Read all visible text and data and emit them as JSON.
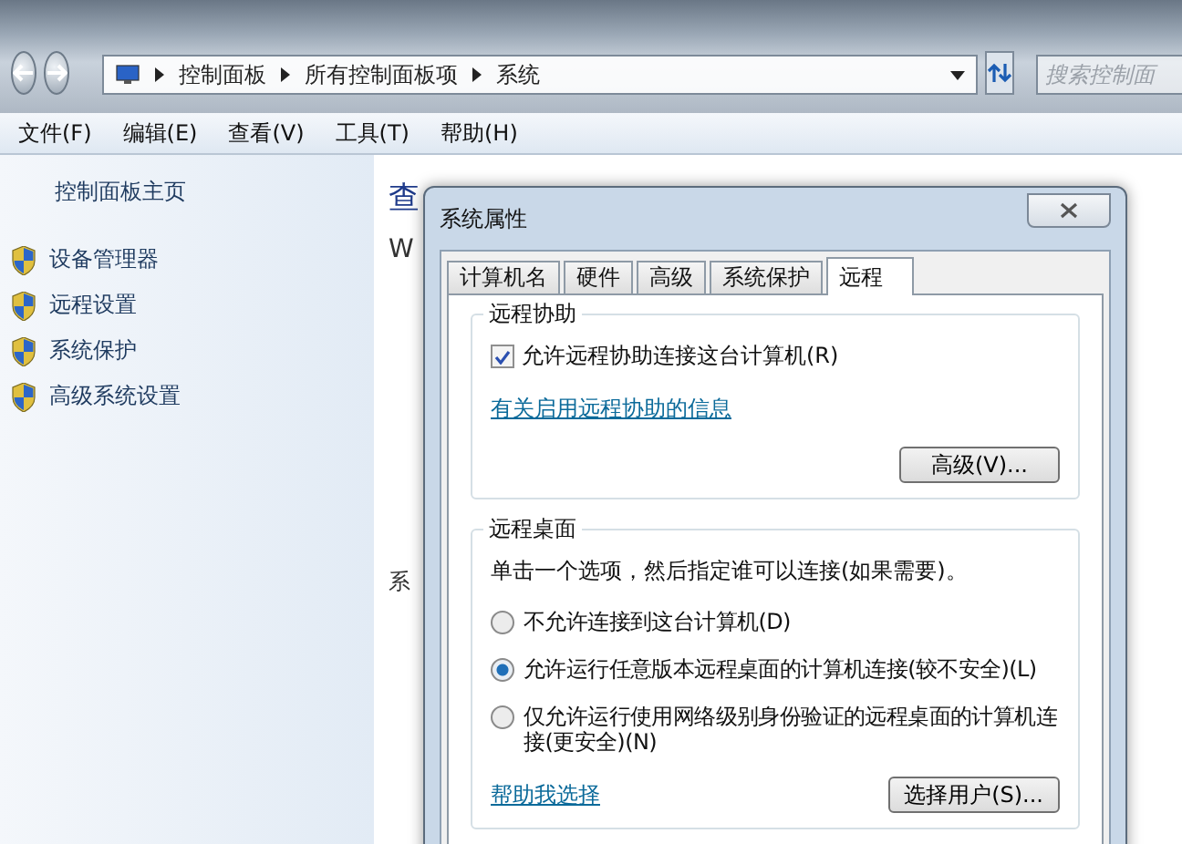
{
  "address_bar": {
    "crumbs": [
      "控制面板",
      "所有控制面板项",
      "系统"
    ]
  },
  "search": {
    "placeholder": "搜索控制面"
  },
  "menu": [
    "文件(F)",
    "编辑(E)",
    "查看(V)",
    "工具(T)",
    "帮助(H)"
  ],
  "sidebar": {
    "home": "控制面板主页",
    "items": [
      "设备管理器",
      "远程设置",
      "系统保护",
      "高级系统设置"
    ]
  },
  "main_fragments": [
    "查",
    "W",
    "系"
  ],
  "dialog": {
    "title": "系统属性",
    "tabs": [
      {
        "label": "计算机名",
        "selected": false
      },
      {
        "label": "硬件",
        "selected": false
      },
      {
        "label": "高级",
        "selected": false
      },
      {
        "label": "系统保护",
        "selected": false
      },
      {
        "label": "远程",
        "selected": true
      }
    ],
    "remote_assistance": {
      "legend": "远程协助",
      "checkbox": {
        "label": "允许远程协助连接这台计算机(R)",
        "checked": true
      },
      "link": "有关启用远程协助的信息",
      "button": "高级(V)..."
    },
    "remote_desktop": {
      "legend": "远程桌面",
      "hint": "单击一个选项，然后指定谁可以连接(如果需要)。",
      "options": [
        {
          "label": "不允许连接到这台计算机(D)",
          "selected": false
        },
        {
          "label": "允许运行任意版本远程桌面的计算机连接(较不安全)(L)",
          "selected": true
        },
        {
          "label": "仅允许运行使用网络级别身份验证的远程桌面的计算机连接(更安全)(N)",
          "selected": false
        }
      ],
      "link": "帮助我选择",
      "button": "选择用户(S)..."
    }
  }
}
